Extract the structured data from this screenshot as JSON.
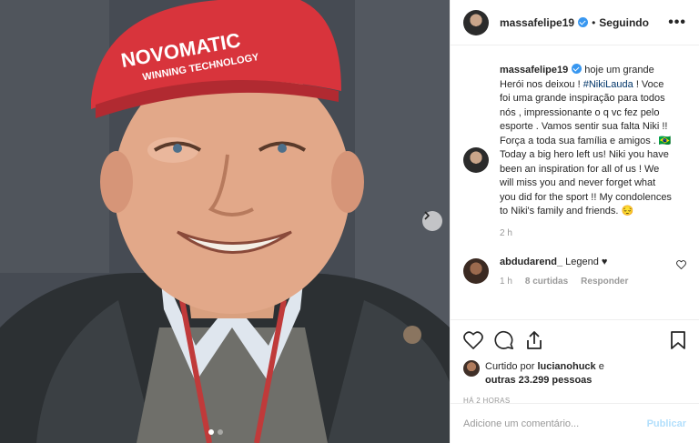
{
  "post": {
    "username": "massafelipe19",
    "separator": "•",
    "follow_status": "Seguindo",
    "more_label": "•••",
    "cap_text": "NOVOMATIC",
    "cap_subtext": "WINNING TECHNOLOGY",
    "caption": {
      "username": "massafelipe19",
      "text_before": " hoje um grande Herói nos deixou ! ",
      "hashtag": "#NikiLauda",
      "text_after": " ! Voce foi uma grande inspiração para todos nós , impressionante o q vc fez pelo esporte . Vamos sentir sua falta Niki !! Força a toda sua família e amigos . 🇧🇷 Today a big hero left us! Niki you have been an inspiration for all of us ! We will miss you and never forget what you did for the sport !! My condolences to Niki's family and friends. 😔",
      "time": "2 h"
    },
    "reply": {
      "username": "abdudarend_",
      "text": " Legend ♥",
      "time": "1 h",
      "likes": "8 curtidas",
      "reply_label": "Responder"
    },
    "likes": {
      "prefix": "Curtido por ",
      "user": "lucianohuck",
      "middle": " e ",
      "others": "outras 23.299 pessoas"
    },
    "posted_ago": "HÁ 2 HORAS",
    "comment_input": {
      "placeholder": "Adicione um comentário..."
    },
    "publish_label": "Publicar"
  },
  "colors": {
    "accent": "#3897f0",
    "hashtag": "#003569",
    "cap_red": "#d8343c",
    "publish_disabled": "#b2dffc"
  },
  "icons": [
    "verified-badge-icon",
    "more-options-icon",
    "next-arrow-icon",
    "heart-icon",
    "comment-icon",
    "share-icon",
    "bookmark-icon"
  ]
}
